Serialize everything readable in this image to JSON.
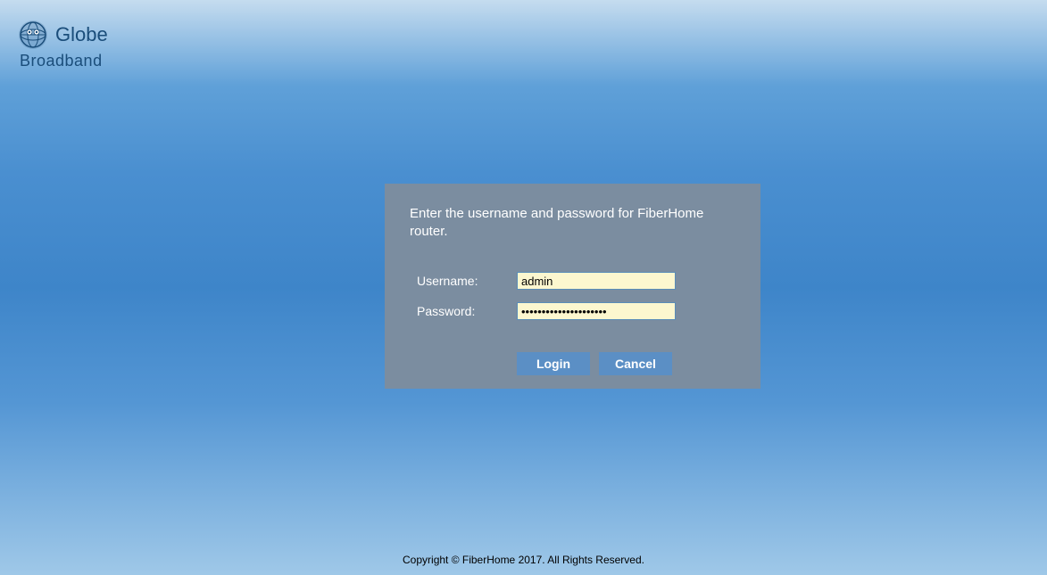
{
  "logo": {
    "brand": "Globe",
    "subbrand": "Broadband"
  },
  "login": {
    "instruction": "Enter the username and password for FiberHome router.",
    "username_label": "Username:",
    "username_value": "admin",
    "password_label": "Password:",
    "password_value": "•••••••••••••••••••••",
    "login_button": "Login",
    "cancel_button": "Cancel"
  },
  "footer": {
    "copyright": "Copyright © FiberHome 2017. All Rights Reserved."
  }
}
